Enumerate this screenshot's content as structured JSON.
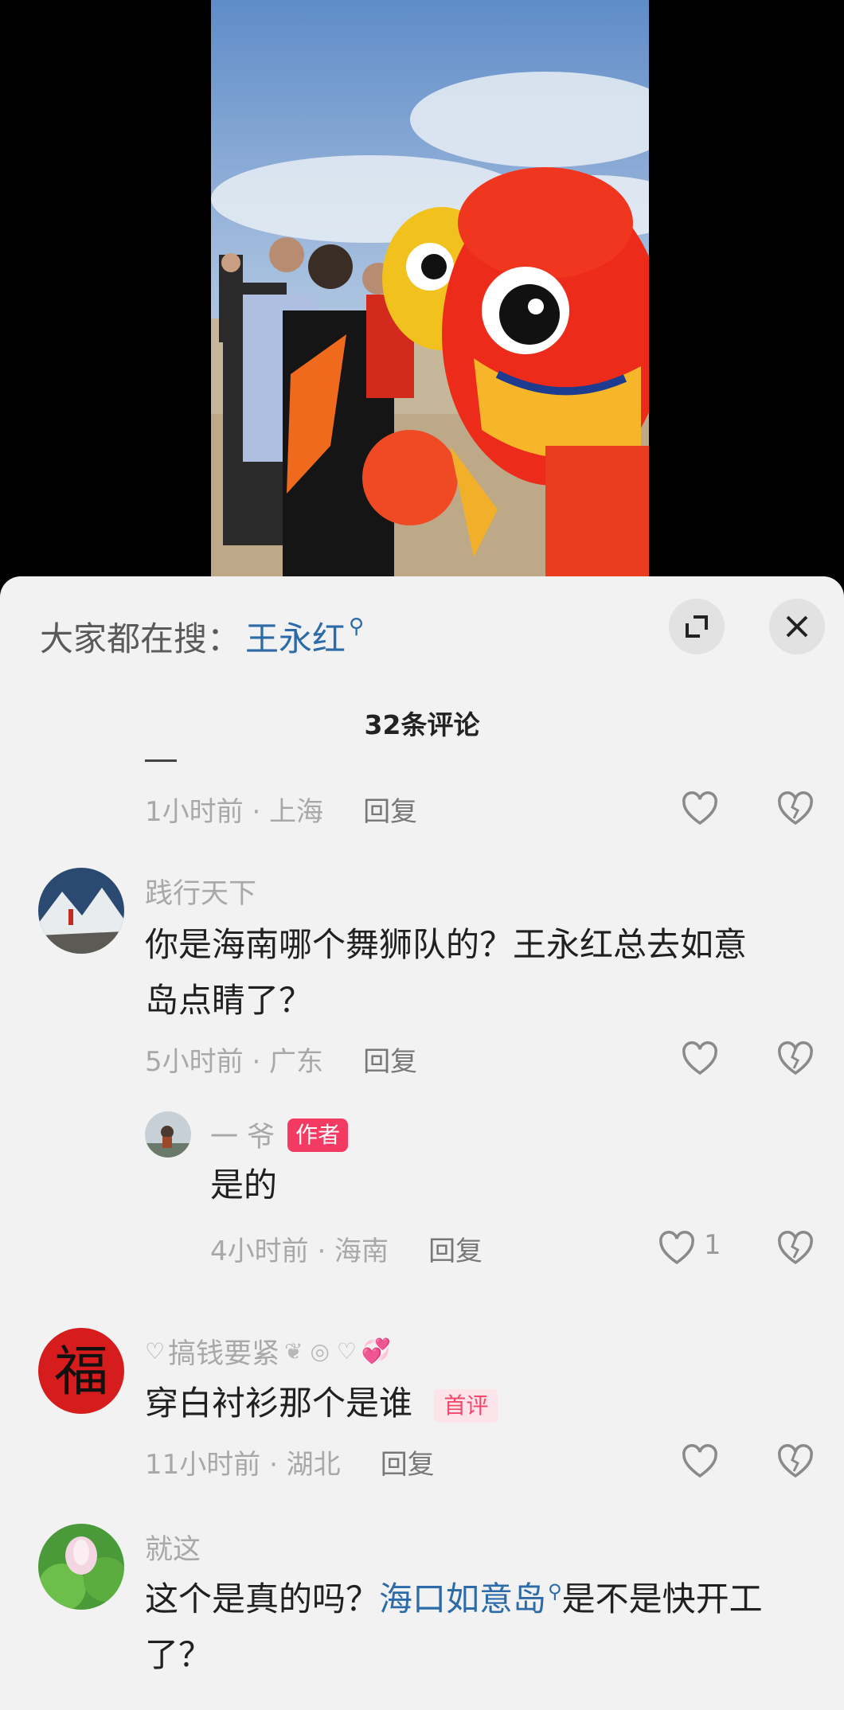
{
  "search_bar": {
    "prefix": "大家都在搜：",
    "query": "王永红"
  },
  "comment_count": "32条评论",
  "comments": [
    {
      "time_location": "1小时前 · 上海",
      "reply": "回复"
    },
    {
      "username": "践行天下",
      "text": "你是海南哪个舞狮队的？王永红总去如意岛点睛了？",
      "line1": "你是海南哪个舞狮队的？王永红总去如意",
      "line2": "岛点睛了？",
      "time_location": "5小时前 · 广东",
      "reply": "回复",
      "replies": [
        {
          "username": "一 爷",
          "badge": "作者",
          "text": "是的",
          "time_location": "4小时前 · 海南",
          "reply": "回复",
          "likes": "1"
        }
      ]
    },
    {
      "username": "搞钱要紧",
      "text": "穿白衬衫那个是谁",
      "badge": "首评",
      "time_location": "11小时前 · 湖北",
      "reply": "回复"
    },
    {
      "username": "就这",
      "text_before": "这个是真的吗？",
      "link": "海口如意岛",
      "text_after": "是不是快开工",
      "line2": "了？"
    }
  ],
  "colors": {
    "accent_link": "#2d6aa8",
    "author_badge": "#f23a63",
    "sheet_bg": "#f2f2f2"
  }
}
